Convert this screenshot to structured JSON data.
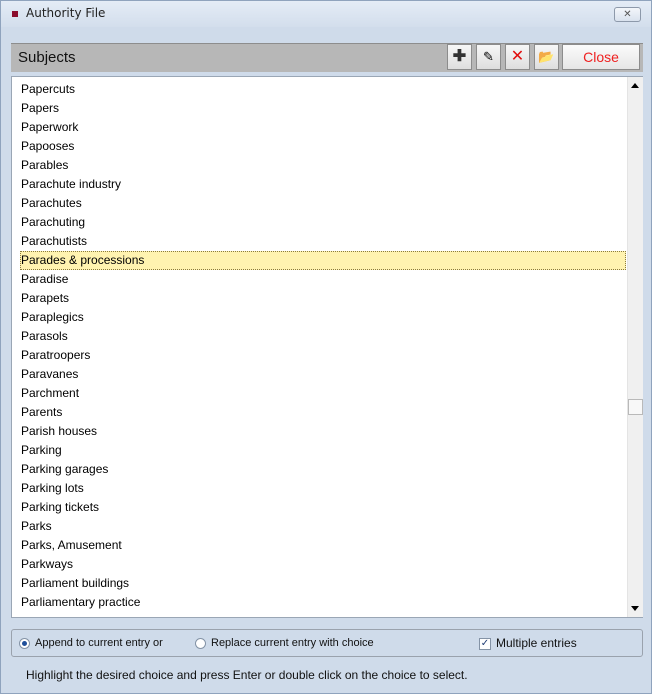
{
  "window": {
    "title": "Authority File",
    "close_glyph": "✕"
  },
  "header": {
    "title": "Subjects",
    "toolbar": [
      {
        "name": "add-button",
        "icon": "plus-icon",
        "glyph": "✚"
      },
      {
        "name": "edit-button",
        "icon": "edit-icon",
        "glyph": "✎"
      },
      {
        "name": "delete-button",
        "icon": "delete-icon",
        "glyph": "✕"
      },
      {
        "name": "open-button",
        "icon": "folder-open-icon",
        "glyph": "📂"
      }
    ],
    "close_label": "Close"
  },
  "list": {
    "items": [
      "Papercuts",
      "Papers",
      "Paperwork",
      "Papooses",
      "Parables",
      "Parachute industry",
      "Parachutes",
      "Parachuting",
      "Parachutists",
      "Parades & processions",
      "Paradise",
      "Parapets",
      "Paraplegics",
      "Parasols",
      "Paratroopers",
      "Paravanes",
      "Parchment",
      "Parents",
      "Parish houses",
      "Parking",
      "Parking garages",
      "Parking lots",
      "Parking tickets",
      "Parks",
      "Parks, Amusement",
      "Parkways",
      "Parliament buildings",
      "Parliamentary practice"
    ],
    "selected_index": 9,
    "scroll_position": 0.62
  },
  "options": {
    "append_label": "Append to current entry or",
    "replace_label": "Replace current entry with choice",
    "selected_mode": "append",
    "multiple_label": "Multiple entries",
    "multiple_checked": true
  },
  "hint": "Highlight the desired choice and press Enter or double click on the choice to select."
}
